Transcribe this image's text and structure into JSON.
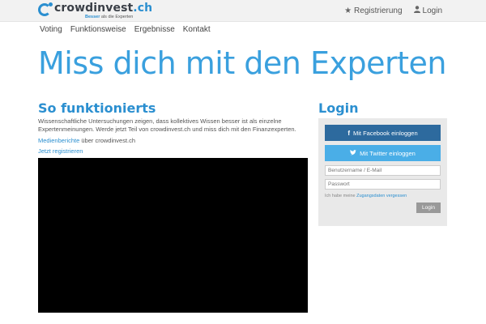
{
  "brand": {
    "name_main": "crowdinvest",
    "name_tld": ".ch",
    "slogan_bold": "Besser",
    "slogan_rest": " als die Experten"
  },
  "topnav": {
    "register": "Registrierung",
    "login": "Login",
    "register_icon": "star-icon",
    "login_icon": "user-icon"
  },
  "mainnav": [
    "Voting",
    "Funktionsweise",
    "Ergebnisse",
    "Kontakt"
  ],
  "hero": "Miss dich mit den Experten",
  "howto": {
    "title": "So funktionierts",
    "text": "Wissenschaftliche Untersuchungen zeigen, dass kollektives Wissen besser ist als einzelne Expertenmeinungen. Werde jetzt Teil von crowdinvest.ch und miss dich mit den Finanzexperten.",
    "press_link": "Medienberichte",
    "press_rest": " über crowdinvest.ch",
    "register_link": "Jetzt registrieren"
  },
  "login": {
    "title": "Login",
    "facebook_label": "Mit Facebook einloggen",
    "twitter_label": "Mit Twitter einloggen",
    "username_placeholder": "Benutzername / E-Mail",
    "password_placeholder": "Passwort",
    "forgot_prefix": "Ich habe meine ",
    "forgot_link": "Zugangsdaten vergessen",
    "submit": "Login"
  },
  "colors": {
    "accent": "#2b8fd0",
    "hero": "#3aa0de",
    "facebook": "#2d6a9e",
    "twitter": "#4aaee7",
    "login_button": "#999999"
  }
}
